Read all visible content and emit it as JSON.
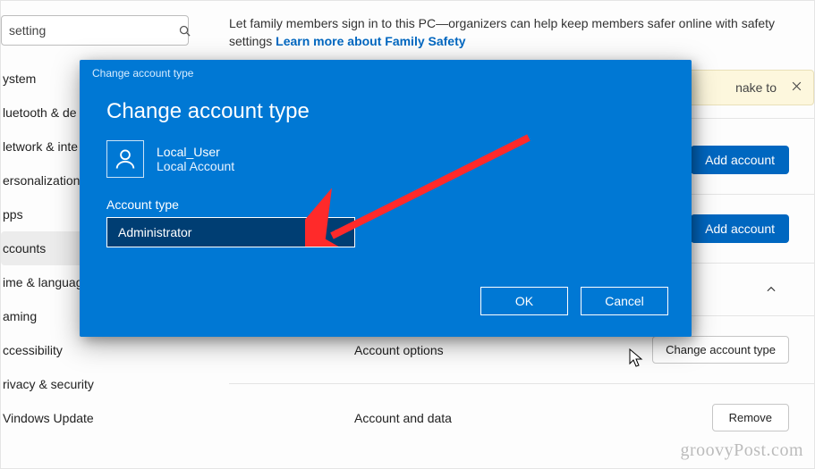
{
  "search": {
    "value": "setting"
  },
  "sidebar": {
    "items": [
      {
        "label": "ystem"
      },
      {
        "label": "luetooth & de"
      },
      {
        "label": "letwork & inte"
      },
      {
        "label": "ersonalization"
      },
      {
        "label": "pps"
      },
      {
        "label": "ccounts",
        "active": true
      },
      {
        "label": "ime & language"
      },
      {
        "label": "aming"
      },
      {
        "label": "ccessibility"
      },
      {
        "label": "rivacy & security"
      },
      {
        "label": "Vindows Update"
      }
    ]
  },
  "top": {
    "blurb_prefix": "Let family members sign in to this PC—organizers can help keep members safer online with safety settings  ",
    "blurb_link": "Learn more about Family Safety"
  },
  "notice": {
    "text_suffix": "nake to"
  },
  "rows": {
    "add_account_1": "Add account",
    "add_account_2": "Add account",
    "account_options": "Account options",
    "change_btn": "Change account type",
    "account_data": "Account and data",
    "remove_btn": "Remove"
  },
  "modal": {
    "header": "Change account type",
    "title": "Change account type",
    "user_name": "Local_User",
    "user_sub": "Local Account",
    "field_label": "Account type",
    "select_value": "Administrator",
    "ok": "OK",
    "cancel": "Cancel"
  },
  "watermark": "groovyPost.com"
}
